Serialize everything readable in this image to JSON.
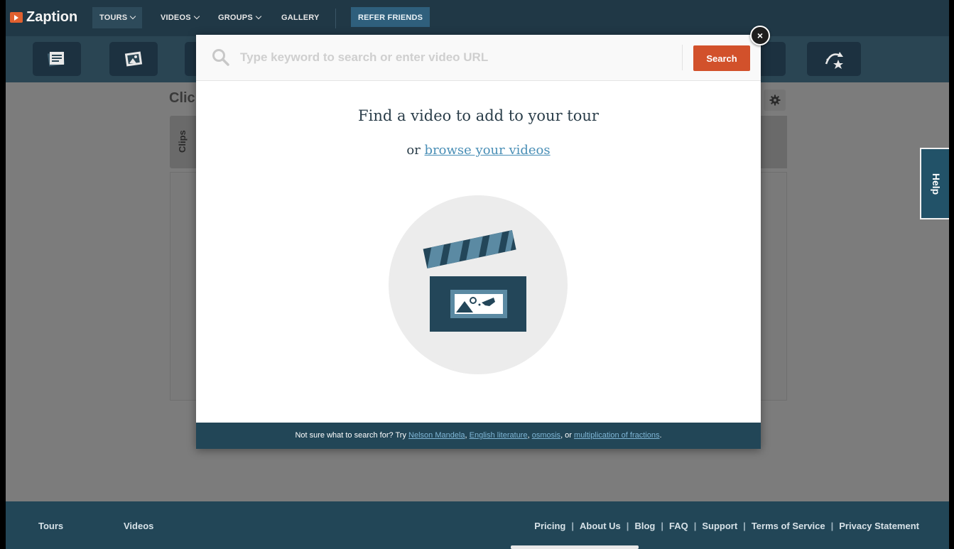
{
  "app": {
    "name": "Zaption"
  },
  "nav": {
    "tours": "TOURS",
    "videos": "VIDEOS",
    "groups": "GROUPS",
    "gallery": "GALLERY",
    "refer": "REFER FRIENDS"
  },
  "editor": {
    "title": "Clic",
    "clips_tab": "Clips"
  },
  "help": {
    "label": "Help"
  },
  "modal": {
    "search_placeholder": "Type keyword to search or enter video URL",
    "search_value": "",
    "search_button": "Search",
    "close_symbol": "×",
    "heading": "Find a video to add to your tour",
    "sub_prefix": "or",
    "sub_link": "browse your videos",
    "footer": {
      "prefix": "Not sure what to search for? Try",
      "suggestions": [
        "Nelson Mandela",
        "English literature",
        "osmosis",
        "multiplication of fractions"
      ],
      "sep1": ",",
      "sep2": ",",
      "sep3": ", or",
      "end": "."
    }
  },
  "footer": {
    "col1": "Tours",
    "col2": "Videos",
    "links": [
      "Pricing",
      "About Us",
      "Blog",
      "FAQ",
      "Support",
      "Terms of Service",
      "Privacy Statement"
    ],
    "separator": "|"
  },
  "icons": {
    "logo": "zaption-play-icon",
    "search": "search-icon",
    "close": "close-icon",
    "gear": "gear-icon",
    "clapperboard": "clapperboard-icon"
  },
  "colors": {
    "nav_bg": "#203846",
    "footer_bg": "#224657",
    "accent": "#d2512b",
    "link": "#4a8fb6"
  }
}
